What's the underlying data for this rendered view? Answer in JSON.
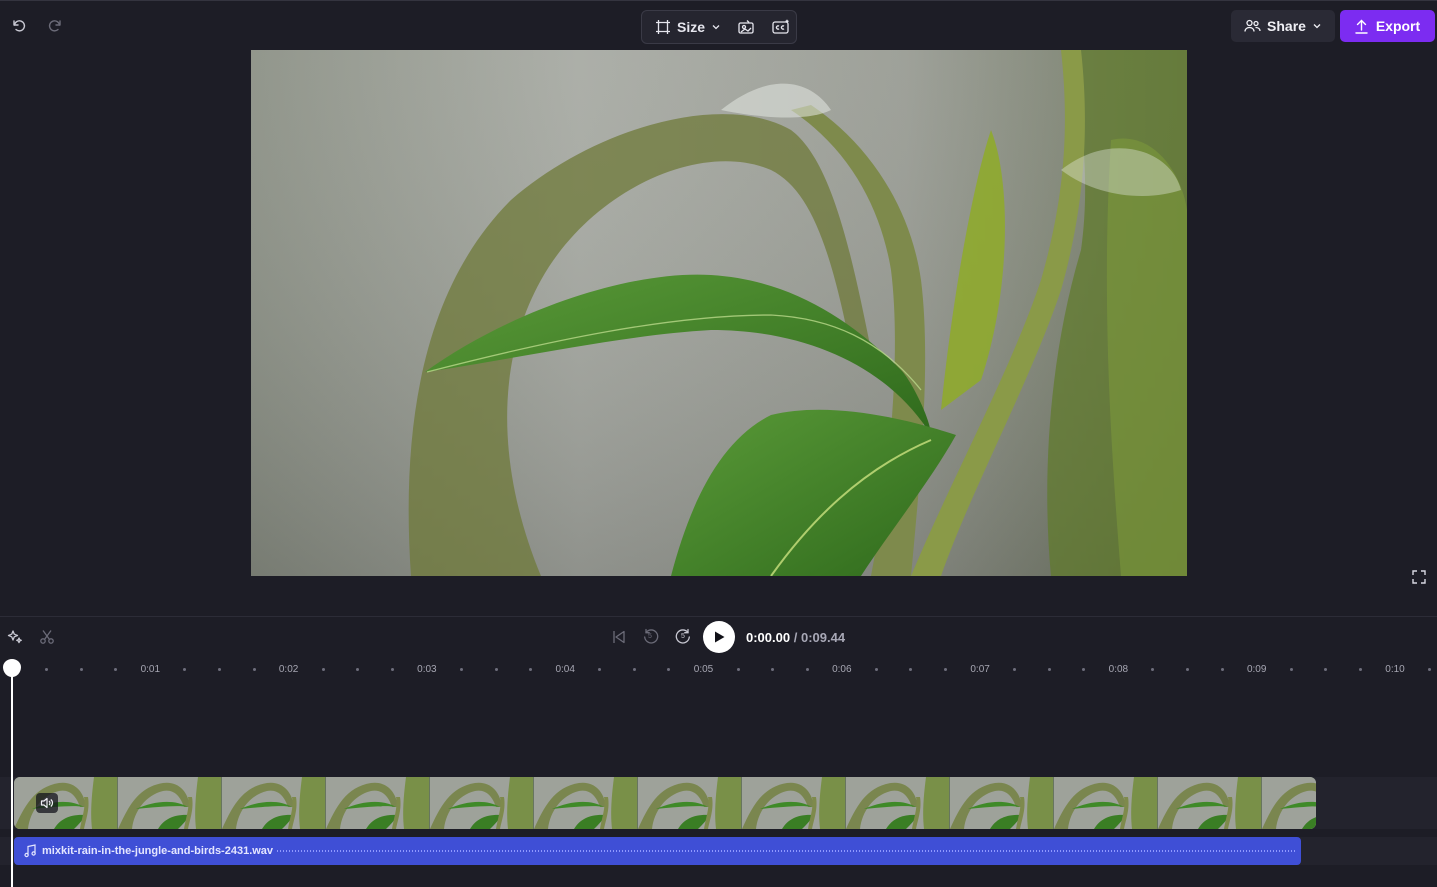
{
  "toolbar": {
    "size_label": "Size",
    "share_label": "Share",
    "export_label": "Export",
    "accent_color": "#7c2cf1"
  },
  "icons": {
    "undo": "undo-icon",
    "redo": "redo-icon",
    "size": "resize-icon",
    "backgrounds": "fill-background-icon",
    "captions": "captions-icon",
    "share": "people-icon",
    "export": "upload-icon",
    "fullscreen": "fullscreen-icon",
    "magic": "sparkle-icon",
    "split": "scissors-icon",
    "skip_start": "skip-to-start-icon",
    "rewind": "rewind-5-icon",
    "forward": "forward-5-icon",
    "play": "play-icon",
    "volume": "speaker-icon",
    "music": "music-note-icon"
  },
  "playback": {
    "current_time": "0:00.00",
    "separator": "/",
    "duration": "0:09.44",
    "rewind_seconds": "5",
    "forward_seconds": "5"
  },
  "timeline": {
    "ruler_labels": [
      "0:01",
      "0:02",
      "0:03",
      "0:04",
      "0:05",
      "0:06",
      "0:07",
      "0:08",
      "0:09",
      "0:10"
    ]
  },
  "tracks": {
    "audio": {
      "filename": "mixkit-rain-in-the-jungle-and-birds-2431.wav",
      "color": "#3f4fd6"
    }
  }
}
